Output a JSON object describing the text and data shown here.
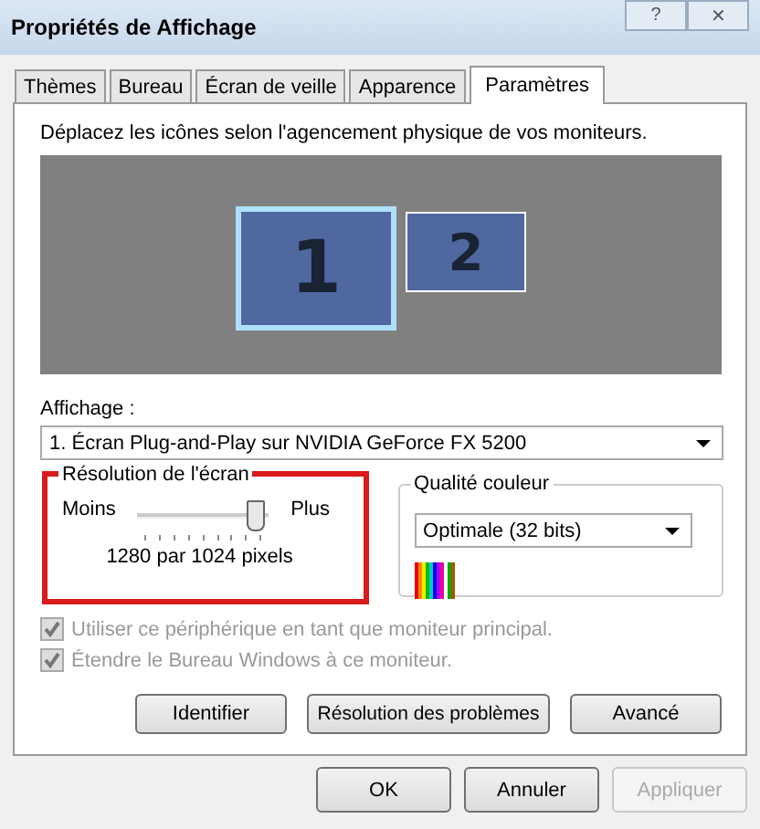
{
  "window": {
    "title": "Propriétés de Affichage",
    "help": "?",
    "close": "✕"
  },
  "tabs": [
    {
      "label": "Thèmes",
      "selected": false
    },
    {
      "label": "Bureau",
      "selected": false
    },
    {
      "label": "Écran de veille",
      "selected": false
    },
    {
      "label": "Apparence",
      "selected": false
    },
    {
      "label": "Paramètres",
      "selected": true
    }
  ],
  "instruction": "Déplacez les icônes selon l'agencement physique de vos moniteurs.",
  "monitors": [
    {
      "label": "1",
      "selected": true
    },
    {
      "label": "2",
      "selected": false
    }
  ],
  "display": {
    "label": "Affichage :",
    "value": "1. Écran Plug-and-Play sur NVIDIA GeForce FX 5200"
  },
  "resolution": {
    "title": "Résolution de l'écran",
    "highlighted": true,
    "min_label": "Moins",
    "max_label": "Plus",
    "level": 0.93,
    "reading": "1280 par 1024 pixels"
  },
  "color_quality": {
    "title": "Qualité couleur",
    "value": "Optimale (32 bits)"
  },
  "checkboxes": [
    {
      "label": "Utiliser ce périphérique en tant que moniteur principal.",
      "checked": true,
      "disabled": true
    },
    {
      "label": "Étendre le Bureau Windows à ce moniteur.",
      "checked": true,
      "disabled": true
    }
  ],
  "panel_buttons": [
    {
      "label": "Identifier",
      "disabled": false
    },
    {
      "label": "Résolution des problèmes",
      "disabled": false
    },
    {
      "label": "Avancé",
      "disabled": false
    }
  ],
  "dialog_buttons": [
    {
      "label": "OK",
      "disabled": false
    },
    {
      "label": "Annuler",
      "disabled": false
    },
    {
      "label": "Appliquer",
      "disabled": true
    }
  ]
}
